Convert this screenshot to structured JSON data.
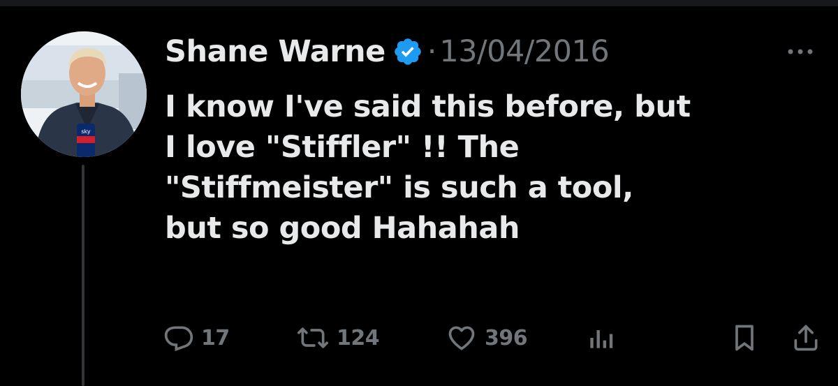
{
  "tweet": {
    "author_name": "Shane Warne",
    "separator": "·",
    "date": "13/04/2016",
    "text_lines": [
      "I know I've said this before, but",
      "I love \"Stiffler\" !! The",
      "\"Stiffmeister\" is such a tool,",
      "but so good Hahahah"
    ]
  },
  "stats": {
    "replies": "17",
    "retweets": "124",
    "likes": "396"
  },
  "icons": {
    "verified": "verified-badge-icon",
    "more": "more-options-icon",
    "reply": "reply-icon",
    "retweet": "retweet-icon",
    "like": "heart-icon",
    "views": "views-chart-icon",
    "bookmark": "bookmark-icon",
    "share": "share-icon"
  },
  "colors": {
    "background": "#000000",
    "text_primary": "#e7e9ea",
    "text_secondary": "#71767b",
    "verified_blue": "#1d9bf0"
  }
}
